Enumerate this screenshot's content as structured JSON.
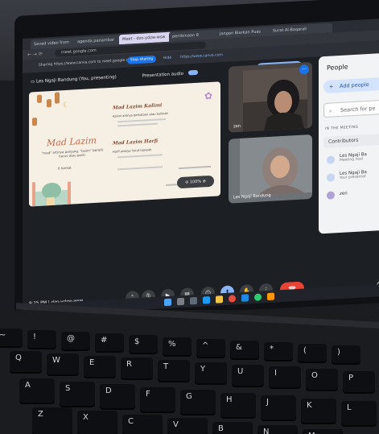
{
  "browser": {
    "tabs": [
      "Saved video from",
      "agenda panambar",
      "Meet - dzo-ydzw-wsw",
      "pembinaan 8",
      "Jangan Biarkan Puas",
      "Surat Al-Baqarah"
    ],
    "url": "meet.google.com",
    "share_notice": "Sharing https://www.canva.com to meet.google.com",
    "share_button": "Stop sharing",
    "hide_button": "Hide",
    "canva_url": "https://www.canva.com"
  },
  "meet": {
    "presenting_label": "Les Ngaji Bandung (You, presenting)",
    "presentation_audio": "Presentation audio",
    "stop_presenting": "Stop presenting",
    "zoom": "100%",
    "clock": "9:25 PM",
    "meeting_code": "dzo-ydzw-wsw",
    "tiles": [
      {
        "name": "zen"
      },
      {
        "name": "Les Ngaji Bandung"
      }
    ],
    "slide": {
      "main_title": "Mad Lazim",
      "main_sub": "\"mad\" artinya panjang, \"lazim\" berarti harus atau pasti.",
      "main_ex": "6 harkat",
      "section1_title": "Mad Lazim Kalimi",
      "section1_body": "Kalimi artinya perkataan atau kalimah",
      "section2_title": "Mad Lazim Harfi",
      "section2_body": "Harfi artinya huruf hijaiyah"
    }
  },
  "people": {
    "title": "People",
    "add": "Add people",
    "search": "Search for pe",
    "section": "IN THE MEETING",
    "contributors": "Contributors",
    "list": [
      {
        "name": "Les Ngaji Ba",
        "role": "Meeting host"
      },
      {
        "name": "Les Ngaji Ba",
        "role": "Your presentat"
      },
      {
        "name": "zen",
        "role": ""
      }
    ]
  },
  "keyboard": {
    "row1": [
      "~",
      "!",
      "@",
      "#",
      "$",
      "%",
      "^",
      "&",
      "*",
      "(",
      ")"
    ],
    "row2": [
      "Q",
      "W",
      "E",
      "R",
      "T",
      "Y",
      "U",
      "I",
      "O",
      "P"
    ],
    "row3": [
      "A",
      "S",
      "D",
      "F",
      "G",
      "H",
      "J",
      "K",
      "L"
    ],
    "row4": [
      "Z",
      "X",
      "C",
      "V",
      "B",
      "N",
      "M"
    ]
  },
  "colors": {
    "accent": "#8ab4f8",
    "end_call": "#ea4335",
    "slide_bg": "#f6efe4"
  }
}
